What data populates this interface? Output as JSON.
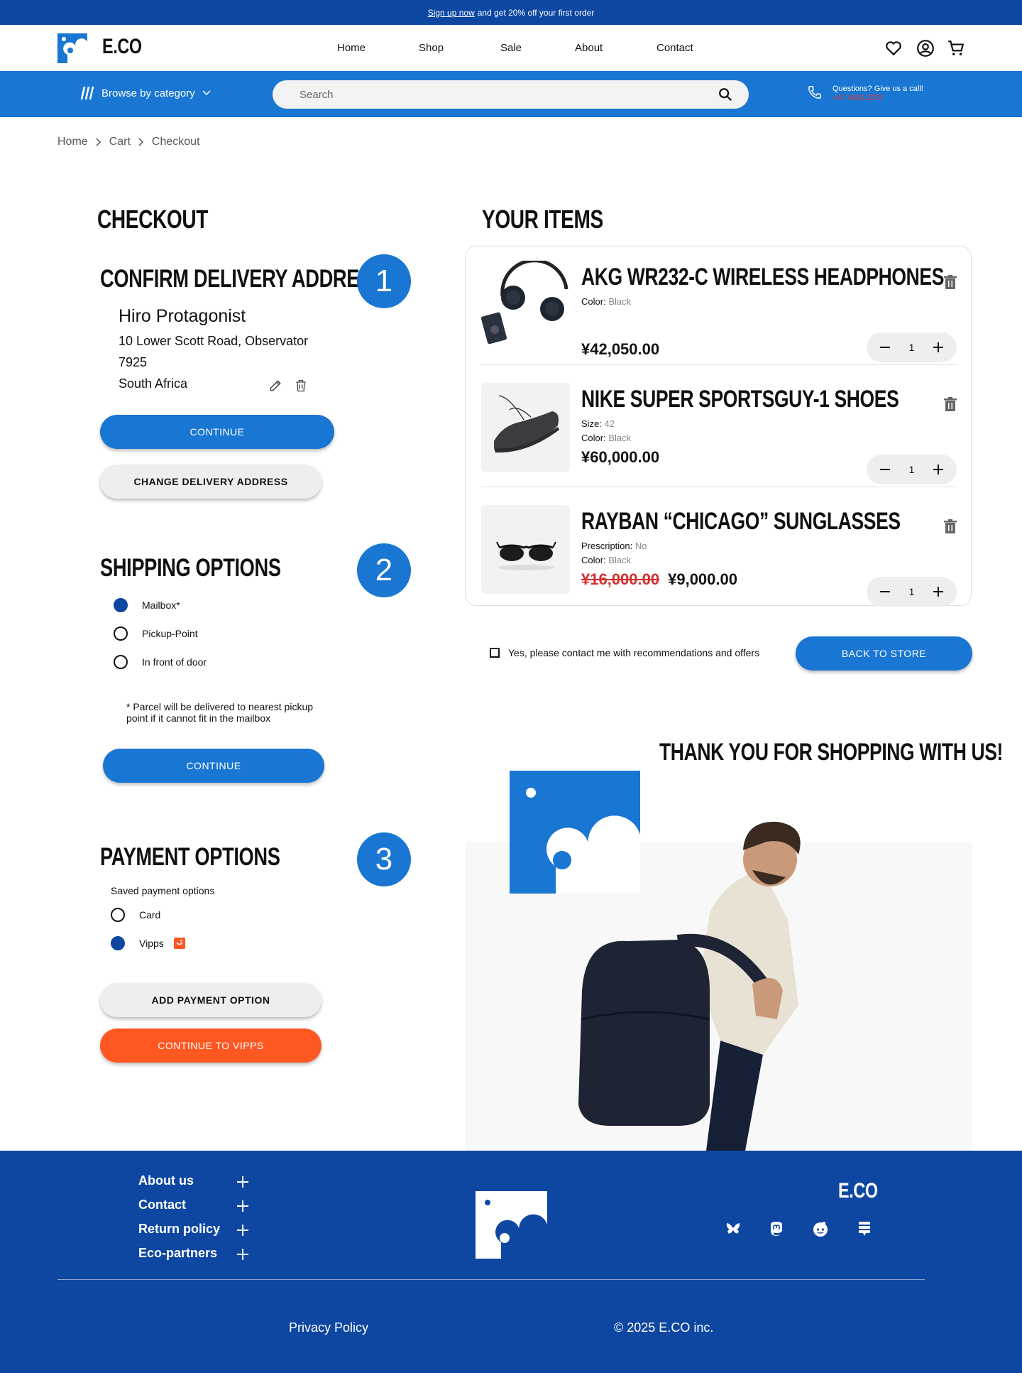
{
  "promo": {
    "link": "Sign up now",
    "text": "and get 20% off your first order"
  },
  "header": {
    "brand": "E.CO",
    "nav": [
      "Home",
      "Shop",
      "Sale",
      "About",
      "Contact"
    ]
  },
  "catbar": {
    "browse_label": "Browse by category",
    "search_placeholder": "Search",
    "help_title": "Questions? Give us a call!",
    "help_phone": "+47 45612378"
  },
  "breadcrumb": [
    "Home",
    "Cart",
    "Checkout"
  ],
  "checkout": {
    "title": "CHECKOUT",
    "step1": {
      "number": "1",
      "title": "CONFIRM DELIVERY ADDRESS",
      "name": "Hiro Protagonist",
      "address_line1": "10 Lower Scott Road, Observator",
      "address_line2": "7925",
      "country": "South Africa",
      "continue_label": "CONTINUE",
      "change_label": "CHANGE DELIVERY ADDRESS"
    },
    "step2": {
      "number": "2",
      "title": "SHIPPING OPTIONS",
      "options": [
        "Mailbox*",
        "Pickup-Point",
        "In front of door"
      ],
      "selected": "Mailbox*",
      "note": "*  Parcel will be delivered to nearest pickup point if it cannot fit in the mailbox",
      "continue_label": "CONTINUE"
    },
    "step3": {
      "number": "3",
      "title": "PAYMENT OPTIONS",
      "saved_label": "Saved payment options",
      "options": [
        "Card",
        "Vipps"
      ],
      "selected": "Vipps",
      "add_label": "ADD PAYMENT OPTION",
      "continue_label": "CONTINUE TO VIPPS"
    }
  },
  "items": {
    "title": "YOUR ITEMS",
    "list": [
      {
        "name": "AKG WR232-C WIRELESS HEADPHONES",
        "attr1_label": "Color:",
        "attr1_value": "Black",
        "price": "¥42,050.00",
        "qty": "1"
      },
      {
        "name": "NIKE SUPER SPORTSGUY-1 SHOES",
        "attr1_label": "Size:",
        "attr1_value": "42",
        "attr2_label": "Color:",
        "attr2_value": "Black",
        "price": "¥60,000.00",
        "qty": "1"
      },
      {
        "name": "RAYBAN “CHICAGO” SUNGLASSES",
        "attr1_label": "Prescription:",
        "attr1_value": "No",
        "attr2_label": "Color:",
        "attr2_value": "Black",
        "old_price": "¥16,000.00",
        "price": "¥9,000.00",
        "qty": "1"
      }
    ],
    "consent": "Yes, please contact me with recommendations and offers",
    "back_label": "BACK TO STORE",
    "thanks": "THANK YOU FOR SHOPPING WITH US!"
  },
  "footer": {
    "links": [
      "About us",
      "Contact",
      "Return policy",
      "Eco-partners"
    ],
    "brand": "E.CO",
    "social_icons": [
      "bluesky-icon",
      "mastodon-icon",
      "reddit-icon",
      "stack-icon"
    ],
    "privacy": "Privacy Policy",
    "copyright": "© 2025 E.CO inc."
  },
  "colors": {
    "primary": "#1976d2",
    "dark_blue": "#0d47a1",
    "orange": "#ff5722",
    "sale_red": "#d32f2f"
  }
}
